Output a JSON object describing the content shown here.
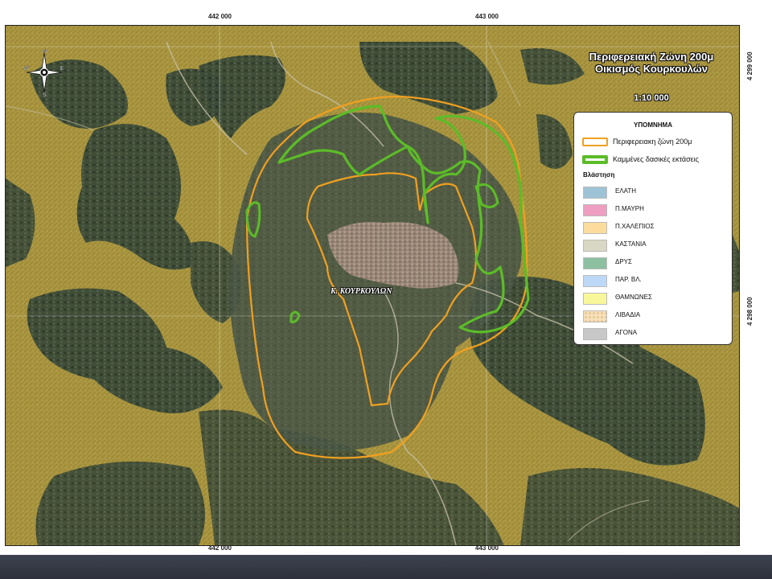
{
  "map": {
    "title_line1": "Περιφερειακή Ζώνη 200μ",
    "title_line2": "Οικισμός Κουρκουλών",
    "scale": "1:10 000",
    "place_label": "Κ. ΚΟΥΡΚΟΥΛΩΝ",
    "grid_labels": {
      "x_left_top": "442 000",
      "x_right_top": "443 000",
      "x_left_bottom": "442 000",
      "x_right_bottom": "443 000",
      "y_top": "4 299 000",
      "y_bottom": "4 298 000"
    },
    "compass": {
      "n": "N",
      "s": "S",
      "e": "E",
      "w": "W"
    }
  },
  "legend": {
    "title": "ΥΠΟΜΝΗΜΑ",
    "buffer_label": "Περιφερειακη ζώνη 200μ",
    "burned_label": "Καμμένες δασικές εκτάσεις",
    "vegetation_title": "Βλάστηση",
    "items": [
      {
        "label": "ΕΛΑΤΗ",
        "color": "#9ec3d6"
      },
      {
        "label": "Π.ΜΑΥΡΗ",
        "color": "#ee9ec0"
      },
      {
        "label": "Π.ΧΑΛΕΠΙΟΣ",
        "color": "#fbdc9c"
      },
      {
        "label": "ΚΑΣΤΑΝΙΑ",
        "color": "#d8d8c4"
      },
      {
        "label": "ΔΡΥΣ",
        "color": "#8cc0a0"
      },
      {
        "label": "ΠΑΡ. ΒΛ.",
        "color": "#bcd8f6"
      },
      {
        "label": "ΘΑΜΝΩΝΕΣ",
        "color": "#f8f89a"
      },
      {
        "label": "ΛΙΒΑΔΙΑ",
        "color": "#f6e0b8"
      },
      {
        "label": "ΑΓΟΝΑ",
        "color": "#c8c8c8"
      }
    ],
    "colors": {
      "buffer_outline": "#f0a020",
      "burned_outline": "#5cbc28",
      "chalepios_overlay": "#b39a2c"
    }
  }
}
